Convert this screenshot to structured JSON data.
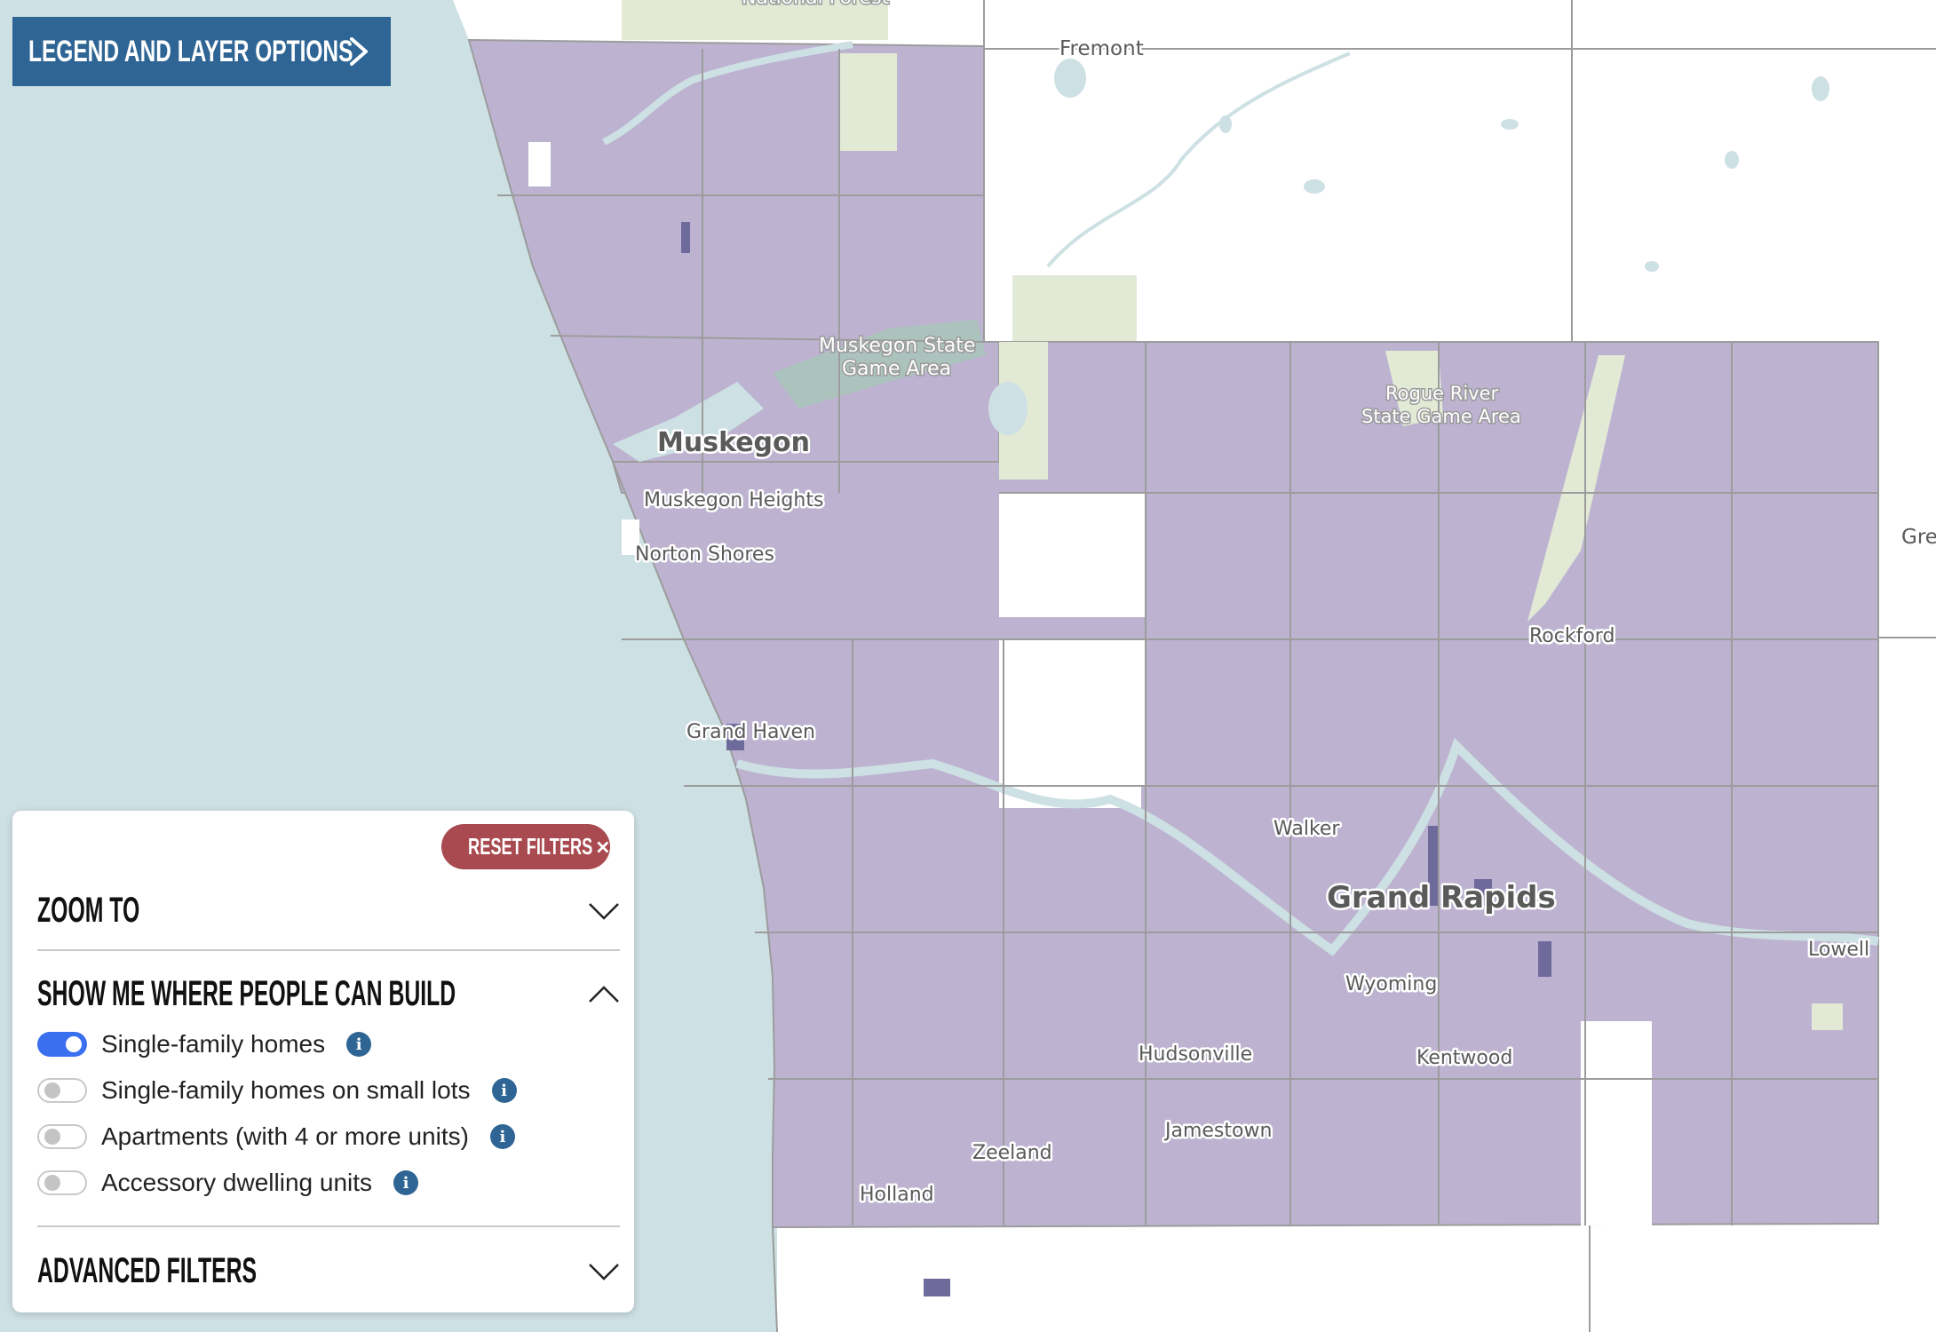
{
  "header": {
    "legend_button_label": "LEGEND AND LAYER OPTIONS",
    "legend_button_icon": "chevron-right-icon"
  },
  "panel": {
    "reset_button_label": "RESET FILTERS",
    "reset_button_icon": "close-icon",
    "sections": [
      {
        "title": "ZOOM TO",
        "expanded": false,
        "icon": "chevron-down-icon"
      },
      {
        "title": "SHOW ME WHERE PEOPLE CAN BUILD",
        "expanded": true,
        "icon": "chevron-up-icon"
      },
      {
        "title": "ADVANCED FILTERS",
        "expanded": false,
        "icon": "chevron-down-icon"
      }
    ],
    "build_options": [
      {
        "label": "Single-family homes",
        "enabled": true,
        "info_icon": "info-icon"
      },
      {
        "label": "Single-family homes on small lots",
        "enabled": false,
        "info_icon": "info-icon"
      },
      {
        "label": "Apartments (with 4 or more units)",
        "enabled": false,
        "info_icon": "info-icon"
      },
      {
        "label": "Accessory dwelling units",
        "enabled": false,
        "info_icon": "info-icon"
      }
    ]
  },
  "map": {
    "colors": {
      "water": "#cde0e3",
      "zoning_fill": "#bdb3d1",
      "dense_zoning": "#6e6a9c",
      "parkland": "#e2ead6",
      "boundary": "#9c9c9c",
      "land": "#ffffff",
      "button_blue": "#2e6594",
      "reset_red": "#a84a4f",
      "toggle_on": "#3a6fef"
    },
    "place_labels": [
      {
        "name": "Fremont",
        "kind": "city"
      },
      {
        "name": "Muskegon",
        "kind": "city-major"
      },
      {
        "name": "Muskegon Heights",
        "kind": "city"
      },
      {
        "name": "Norton Shores",
        "kind": "city"
      },
      {
        "name": "Grand Haven",
        "kind": "city"
      },
      {
        "name": "Walker",
        "kind": "city"
      },
      {
        "name": "Grand Rapids",
        "kind": "city-major"
      },
      {
        "name": "Wyoming",
        "kind": "city"
      },
      {
        "name": "Kentwood",
        "kind": "city"
      },
      {
        "name": "Hudsonville",
        "kind": "city"
      },
      {
        "name": "Jamestown",
        "kind": "city"
      },
      {
        "name": "Zeeland",
        "kind": "city"
      },
      {
        "name": "Holland",
        "kind": "city"
      },
      {
        "name": "Rockford",
        "kind": "city"
      },
      {
        "name": "Lowell",
        "kind": "city"
      },
      {
        "name": "Gre",
        "kind": "city"
      }
    ],
    "park_labels": [
      {
        "line1": "Muskegon State",
        "line2": "Game Area"
      },
      {
        "line1": "Rogue River",
        "line2": "State Game Area"
      },
      {
        "line1": "National Forest",
        "line2": ""
      }
    ]
  }
}
